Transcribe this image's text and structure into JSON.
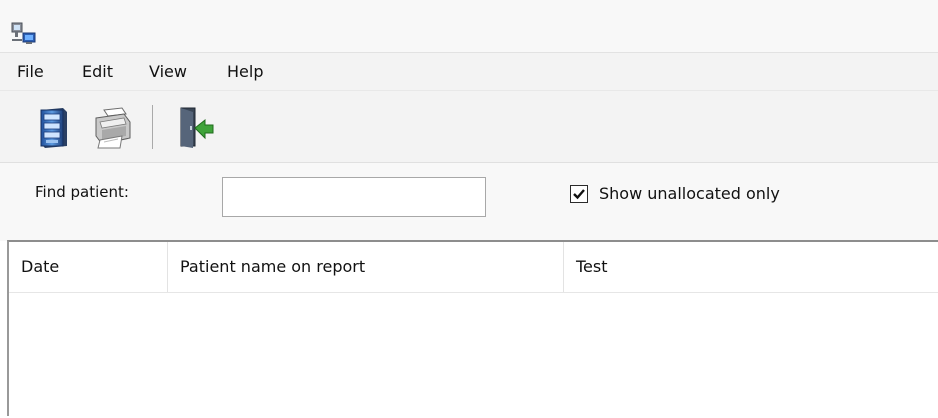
{
  "menu": {
    "file": "File",
    "edit": "Edit",
    "view": "View",
    "help": "Help"
  },
  "toolbar": {
    "buttons": [
      "server-icon",
      "printer-icon",
      "exit-door-icon"
    ]
  },
  "search": {
    "label": "Find patient:",
    "value": "",
    "placeholder": ""
  },
  "filter": {
    "label": "Show unallocated only",
    "checked": true
  },
  "grid": {
    "columns": [
      "Date",
      "Patient name on report",
      "Test"
    ],
    "rows": []
  },
  "colors": {
    "chrome": "#f3f3f3",
    "accent_green": "#3fa33a",
    "accent_blue": "#3a6fb5"
  }
}
